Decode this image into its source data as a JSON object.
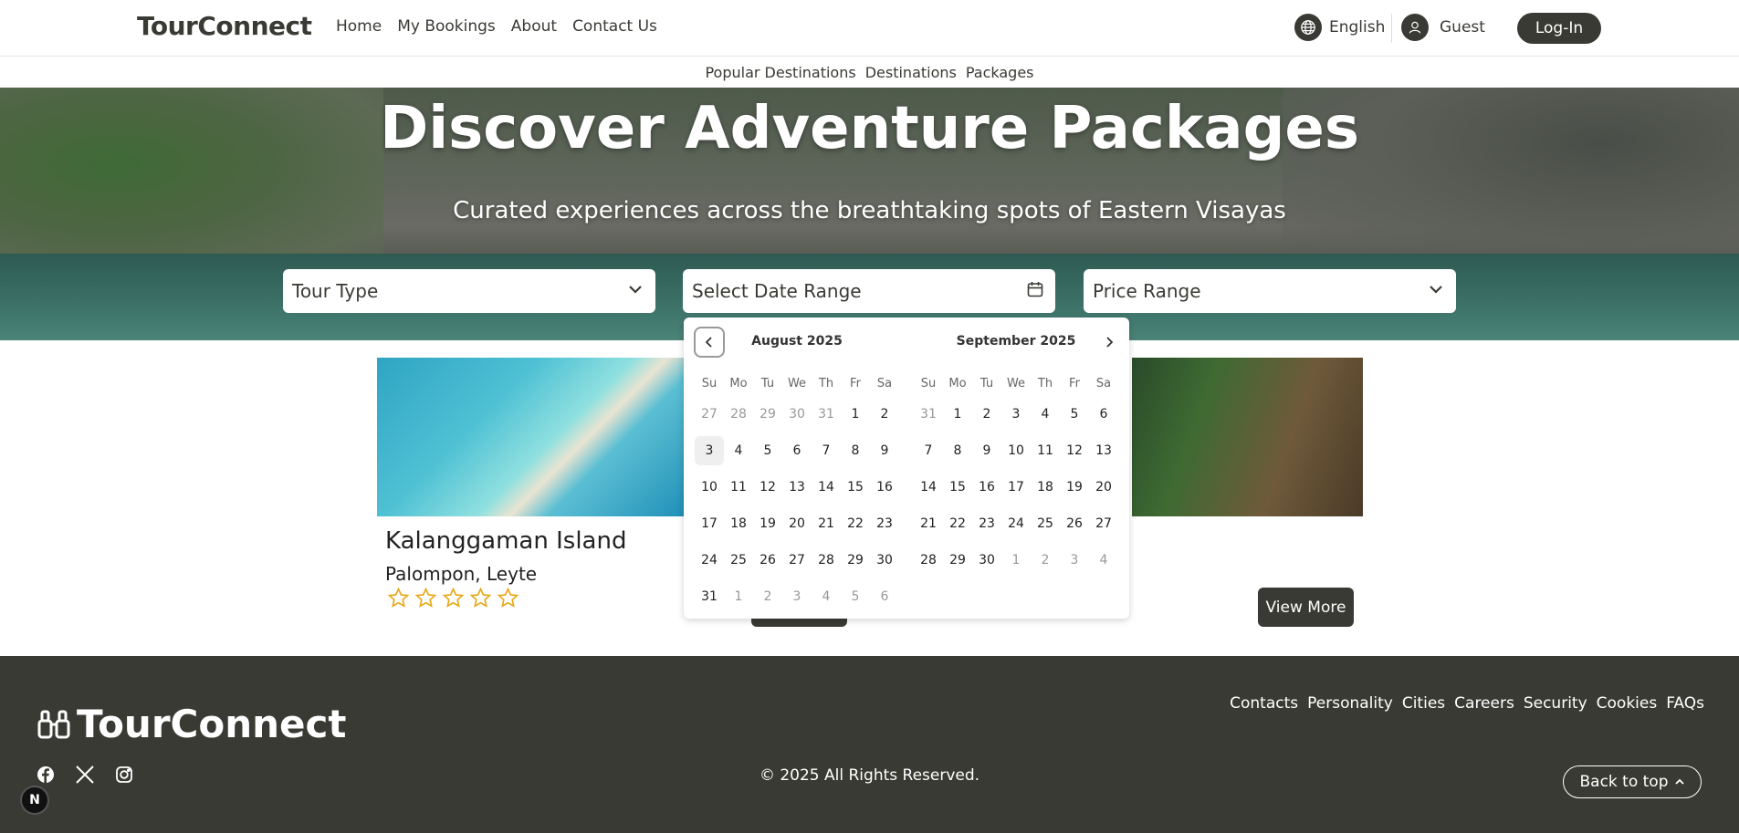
{
  "header": {
    "brand": "TourConnect",
    "nav": [
      "Home",
      "My Bookings",
      "About",
      "Contact Us"
    ],
    "language": "English",
    "user": "Guest",
    "login_label": "Log-In"
  },
  "subnav": [
    "Popular Destinations",
    "Destinations",
    "Packages"
  ],
  "hero": {
    "title": "Discover Adventure Packages",
    "subtitle": "Curated experiences across the breathtaking spots of Eastern Visayas"
  },
  "filters": {
    "tour_type": "Tour Type",
    "date_range": "Select Date Range",
    "price_range": "Price Range"
  },
  "card": {
    "title": "Kalanggaman Island",
    "location": "Palompon, Leyte",
    "rating_filled": 0,
    "rating_max": 5,
    "view_more_label": "View More"
  },
  "calendar": {
    "weekdays": [
      "Su",
      "Mo",
      "Tu",
      "We",
      "Th",
      "Fr",
      "Sa"
    ],
    "months": [
      {
        "title": "August 2025",
        "days": [
          [
            "27",
            "out"
          ],
          [
            "28",
            "out"
          ],
          [
            "29",
            "out"
          ],
          [
            "30",
            "out"
          ],
          [
            "31",
            "out"
          ],
          [
            "1",
            ""
          ],
          [
            "2",
            ""
          ],
          [
            "3",
            "today"
          ],
          [
            "4",
            ""
          ],
          [
            "5",
            ""
          ],
          [
            "6",
            ""
          ],
          [
            "7",
            ""
          ],
          [
            "8",
            ""
          ],
          [
            "9",
            ""
          ],
          [
            "10",
            ""
          ],
          [
            "11",
            ""
          ],
          [
            "12",
            ""
          ],
          [
            "13",
            ""
          ],
          [
            "14",
            ""
          ],
          [
            "15",
            ""
          ],
          [
            "16",
            ""
          ],
          [
            "17",
            ""
          ],
          [
            "18",
            ""
          ],
          [
            "19",
            ""
          ],
          [
            "20",
            ""
          ],
          [
            "21",
            ""
          ],
          [
            "22",
            ""
          ],
          [
            "23",
            ""
          ],
          [
            "24",
            ""
          ],
          [
            "25",
            ""
          ],
          [
            "26",
            ""
          ],
          [
            "27",
            ""
          ],
          [
            "28",
            ""
          ],
          [
            "29",
            ""
          ],
          [
            "30",
            ""
          ],
          [
            "31",
            ""
          ],
          [
            "1",
            "out"
          ],
          [
            "2",
            "out"
          ],
          [
            "3",
            "out"
          ],
          [
            "4",
            "out"
          ],
          [
            "5",
            "out"
          ],
          [
            "6",
            "out"
          ]
        ]
      },
      {
        "title": "September 2025",
        "days": [
          [
            "31",
            "out"
          ],
          [
            "1",
            ""
          ],
          [
            "2",
            ""
          ],
          [
            "3",
            ""
          ],
          [
            "4",
            ""
          ],
          [
            "5",
            ""
          ],
          [
            "6",
            ""
          ],
          [
            "7",
            ""
          ],
          [
            "8",
            ""
          ],
          [
            "9",
            ""
          ],
          [
            "10",
            ""
          ],
          [
            "11",
            ""
          ],
          [
            "12",
            ""
          ],
          [
            "13",
            ""
          ],
          [
            "14",
            ""
          ],
          [
            "15",
            ""
          ],
          [
            "16",
            ""
          ],
          [
            "17",
            ""
          ],
          [
            "18",
            ""
          ],
          [
            "19",
            ""
          ],
          [
            "20",
            ""
          ],
          [
            "21",
            ""
          ],
          [
            "22",
            ""
          ],
          [
            "23",
            ""
          ],
          [
            "24",
            ""
          ],
          [
            "25",
            ""
          ],
          [
            "26",
            ""
          ],
          [
            "27",
            ""
          ],
          [
            "28",
            ""
          ],
          [
            "29",
            ""
          ],
          [
            "30",
            ""
          ],
          [
            "1",
            "out"
          ],
          [
            "2",
            "out"
          ],
          [
            "3",
            "out"
          ],
          [
            "4",
            "out"
          ]
        ]
      }
    ]
  },
  "footer": {
    "brand": "TourConnect",
    "links": [
      "Contacts",
      "Personality",
      "Cities",
      "Careers",
      "Security",
      "Cookies",
      "FAQs"
    ],
    "copyright": "© 2025 All Rights Reserved.",
    "back_to_top": "Back to top",
    "social_icons": [
      "facebook-icon",
      "x-icon",
      "instagram-icon"
    ]
  },
  "badge": "N",
  "colors": {
    "primary_dark": "#3a3a34",
    "star": "#e7a817",
    "white": "#ffffff"
  }
}
